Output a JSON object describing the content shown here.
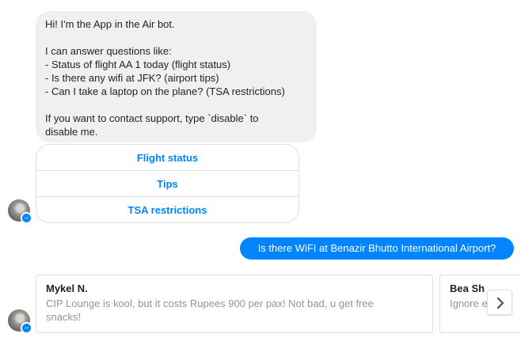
{
  "bot_message": {
    "lines": [
      "Hi! I'm the App in the Air bot.",
      "",
      "I can answer questions like:",
      "- Status of flight AA 1 today (flight status)",
      "- Is there any wifi at JFK? (airport tips)",
      "- Can I take a laptop on the plane? (TSA restrictions)",
      "",
      "If you want to contact support, type `disable` to",
      "disable me."
    ]
  },
  "quick_replies": [
    "Flight status",
    "Tips",
    "TSA restrictions"
  ],
  "user_message": "Is there WiFI at Benazir Bhutto International Airport?",
  "cards": [
    {
      "title": "Mykel N.",
      "subtitle_lines": [
        "CIP Lounge is kool, but it costs Rupees 900 per pax! Not bad, u get free",
        "snacks!"
      ]
    },
    {
      "title": "Bea Sh",
      "subtitle_lines": [
        "Ignore e"
      ]
    }
  ],
  "icons": {
    "avatar_badge": "messenger-icon",
    "next": "chevron-right-icon"
  },
  "colors": {
    "accent": "#0084ff",
    "bot_bubble": "#f1f0f0",
    "border": "#dddfe2",
    "muted_text": "#90949c"
  }
}
